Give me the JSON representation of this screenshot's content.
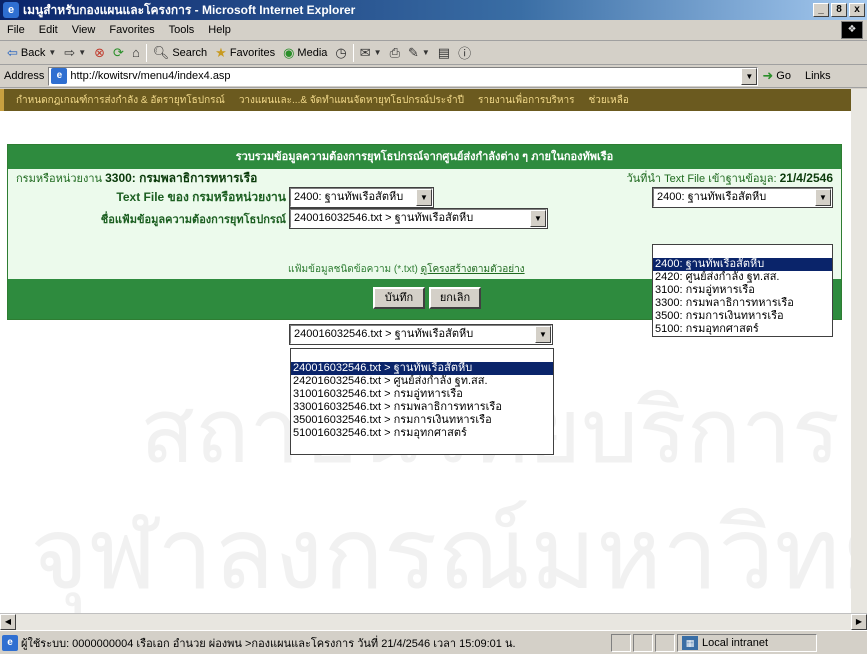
{
  "window": {
    "title": "เมนูสำหรับกองแผนและโครงการ - Microsoft Internet Explorer",
    "buttons": [
      "_",
      "8",
      "x"
    ]
  },
  "menubar": {
    "items": [
      "File",
      "Edit",
      "View",
      "Favorites",
      "Tools",
      "Help"
    ]
  },
  "toolbar": {
    "back": "Back",
    "search": "Search",
    "favorites": "Favorites",
    "media": "Media"
  },
  "address": {
    "label": "Address",
    "url": "http://kowitsrv/menu4/index4.asp",
    "go": "Go",
    "links": "Links"
  },
  "nav": {
    "items": [
      "กำหนดกฎเกณฑ์การส่งกำลัง & อัตรายุทโธปกรณ์",
      "วางแผนและ...& จัดทำแผนจัดหายุทโธปกรณ์ประจำปี",
      "รายงานเพื่อการบริหาร",
      "ช่วยเหลือ"
    ]
  },
  "panel": {
    "header": "รวบรวมข้อมูลความต้องการยุทโธปกรณ์จากศูนย์ส่งกำลังต่าง ๆ ภายในกองทัพเรือ",
    "unit_label": "กรมหรือหน่วยงาน",
    "unit_value": "3300: กรมพลาธิการทหารเรือ",
    "date_label": "วันที่นำ Text File เข้าฐานข้อมูล:",
    "date_value": "21/4/2546",
    "textfile_label": "Text File ของ กรมหรือหน่วยงาน",
    "textfile_select": "2400: ฐานทัพเรือสัตหีบ",
    "filename_label": "ชื่อแฟ้มข้อมูลความต้องการยุทโธปกรณ์",
    "filename_select": "240016032546.txt > ฐานทัพเรือสัตหีบ",
    "right_select": "2400: ฐานทัพเรือสัตหีบ",
    "hint_text": "แฟ้มข้อมูลชนิดข้อความ (*.txt)",
    "hint_link": "ดูโครงสร้างตามตัวอย่าง",
    "save_button": "บันทึก",
    "cancel_button": "ยกเลิก"
  },
  "unit_options": [
    "",
    "2400: ฐานทัพเรือสัตหีบ",
    "2420: ศูนย์ส่งกำลัง ฐท.สส.",
    "3100: กรมอู่ทหารเรือ",
    "3300: กรมพลาธิการทหารเรือ",
    "3500: กรมการเงินทหารเรือ",
    "5100: กรมอุทกศาสตร์"
  ],
  "file_options": [
    "240016032546.txt > ฐานทัพเรือสัตหีบ",
    "",
    "240016032546.txt > ฐานทัพเรือสัตหีบ",
    "242016032546.txt > ศูนย์ส่งกำลัง ฐท.สส.",
    "310016032546.txt > กรมอู่ทหารเรือ",
    "330016032546.txt > กรมพลาธิการทหารเรือ",
    "350016032546.txt > กรมการเงินทหารเรือ",
    "510016032546.txt > กรมอุทกศาสตร์"
  ],
  "watermark": {
    "line1": "สถาบันวิทยบริการ",
    "line2": "จุฬาลงกรณ์มหาวิทยาลัย"
  },
  "status": {
    "text": "ผู้ใช้ระบบ: 0000000004 เรือเอก อำนวย ผ่องพน >กองแผนและโครงการ วันที่ 21/4/2546 เวลา 15:09:01 น.",
    "zone": "Local intranet"
  }
}
